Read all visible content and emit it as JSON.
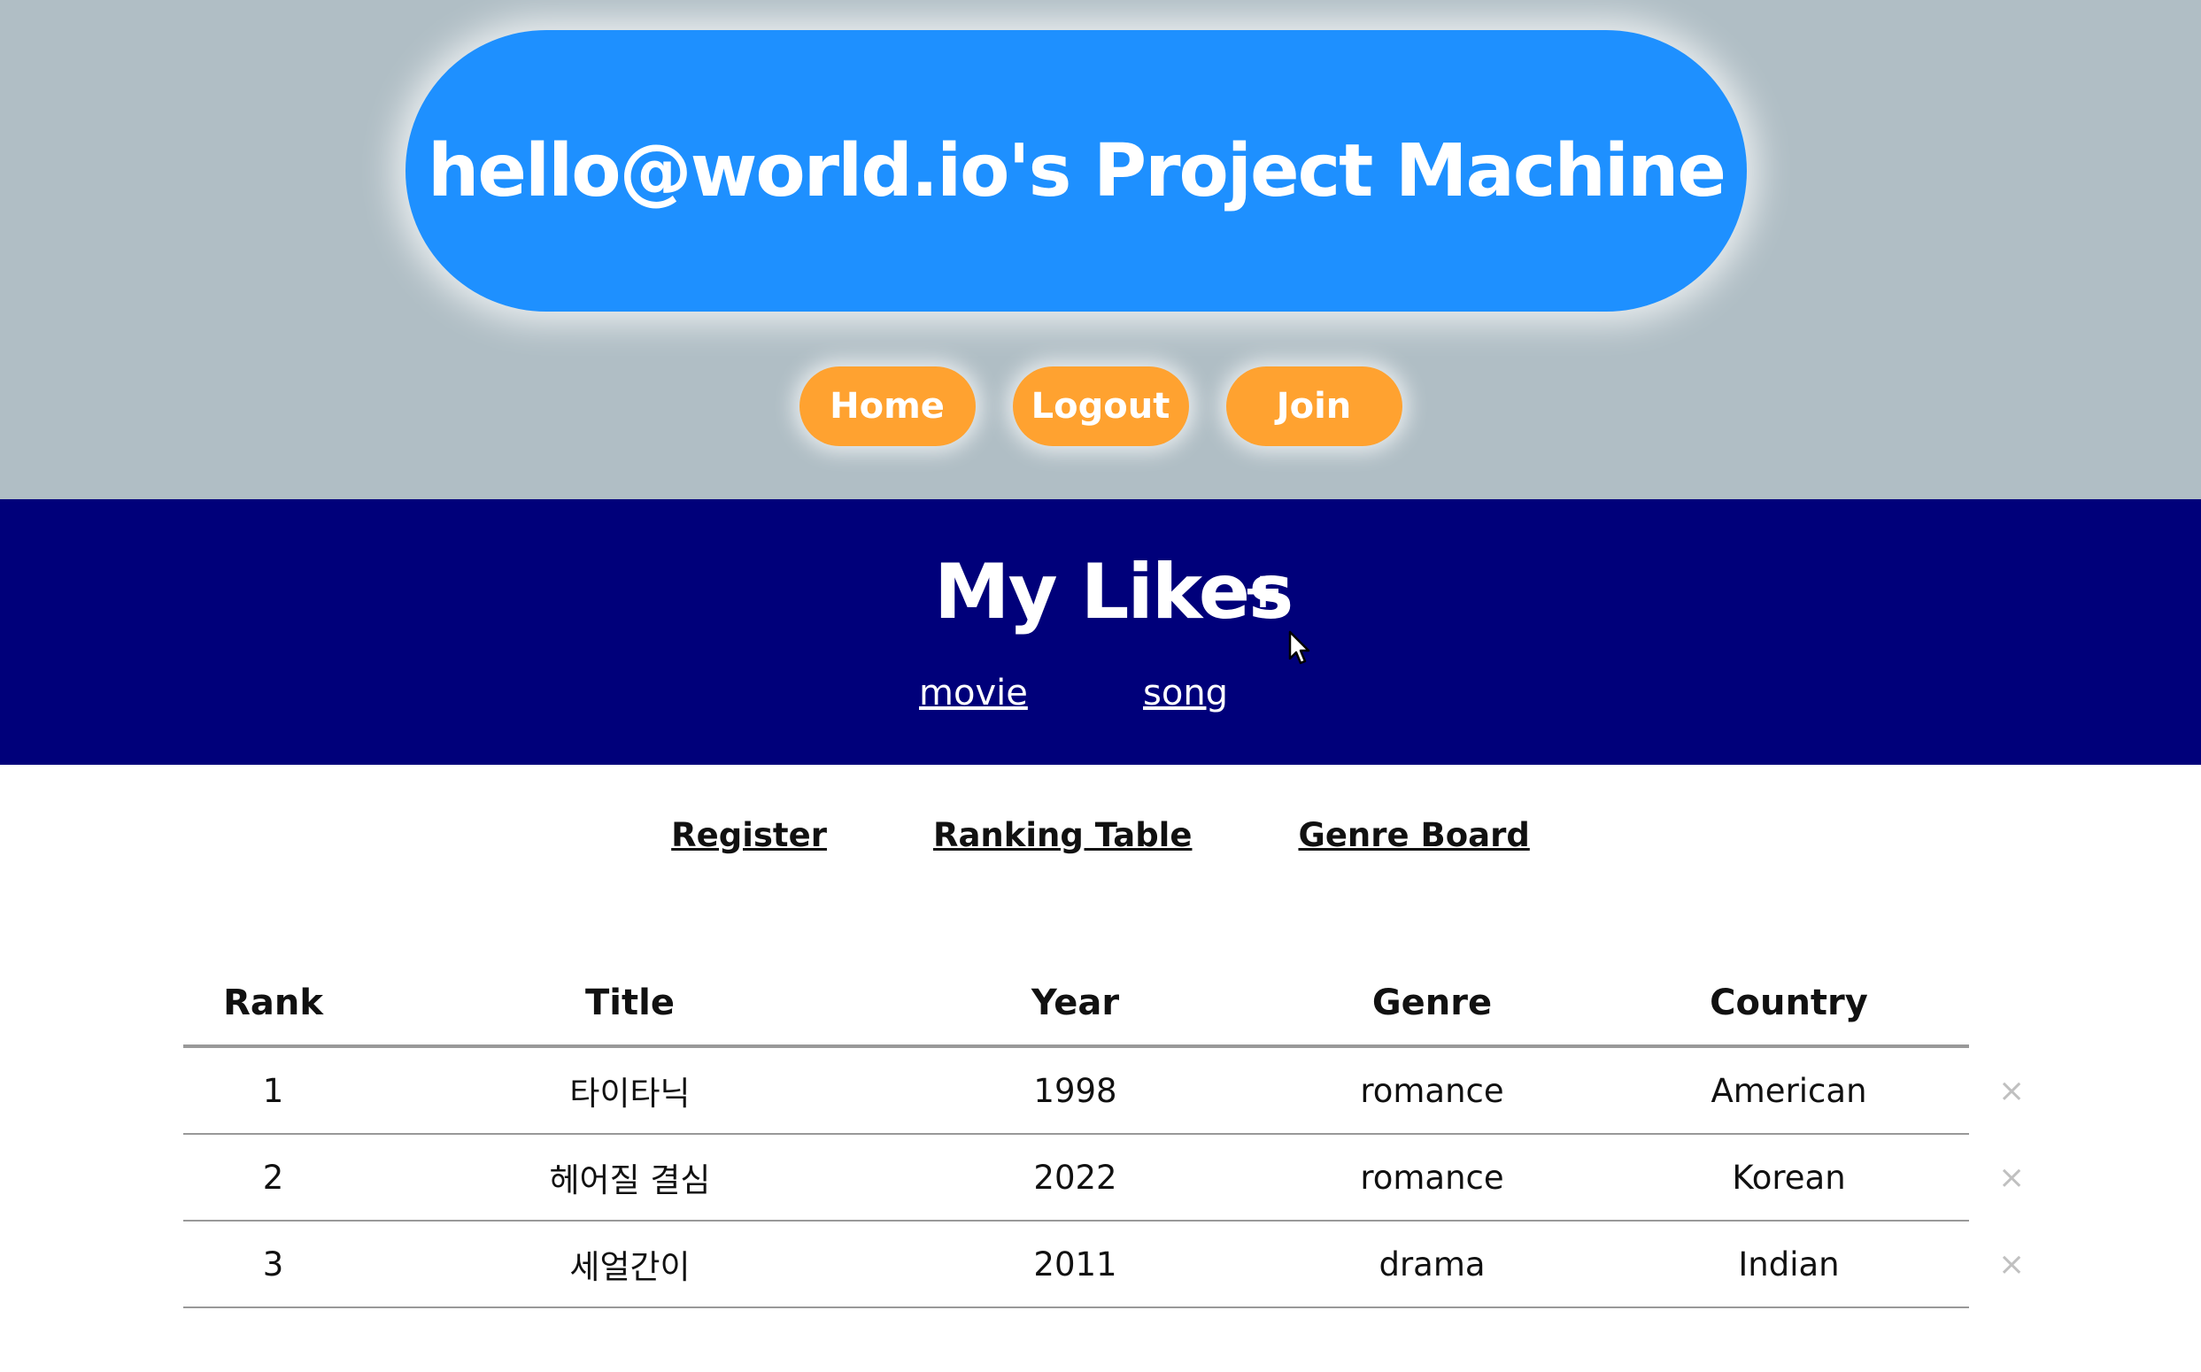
{
  "header": {
    "title": "hello@world.io's Project Machine",
    "nav": [
      "Home",
      "Logout",
      "Join"
    ]
  },
  "likes": {
    "title": "My Likes",
    "add_label": "+",
    "categories": [
      "movie",
      "song"
    ]
  },
  "sub_nav": [
    "Register",
    "Ranking Table",
    "Genre Board"
  ],
  "table": {
    "columns": [
      "Rank",
      "Title",
      "Year",
      "Genre",
      "Country"
    ],
    "rows": [
      {
        "rank": "1",
        "title": "타이타닉",
        "year": "1998",
        "genre": "romance",
        "country": "American",
        "delete": "×"
      },
      {
        "rank": "2",
        "title": "헤어질 결심",
        "year": "2022",
        "genre": "romance",
        "country": "Korean",
        "delete": "×"
      },
      {
        "rank": "3",
        "title": "세얼간이",
        "year": "2011",
        "genre": "drama",
        "country": "Indian",
        "delete": "×"
      }
    ]
  },
  "colors": {
    "top_band": "#b0bec5",
    "title_pill": "#1e90ff",
    "nav_button": "#ffa230",
    "likes_band": "#00007a"
  },
  "icons": {
    "add": "plus-icon",
    "delete": "close-icon",
    "cursor": "mouse-pointer-icon"
  }
}
